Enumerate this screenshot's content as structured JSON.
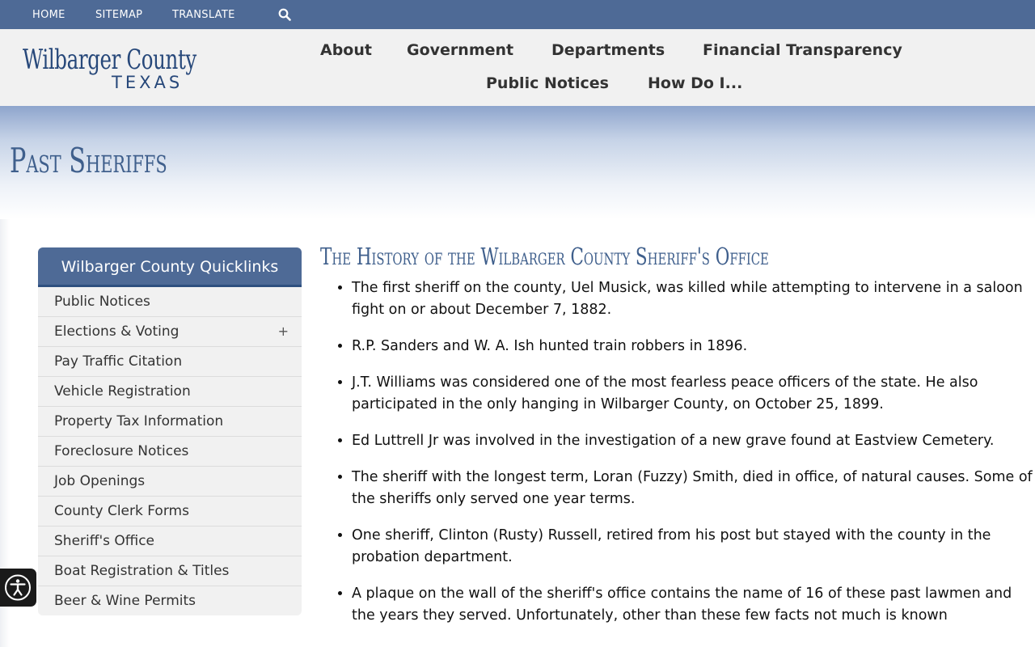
{
  "topbar": {
    "home": "HOME",
    "sitemap": "SITEMAP",
    "translate": "TRANSLATE",
    "search_icon": "search-icon"
  },
  "logo": {
    "line1": "Wilbarger County",
    "line2": "TEXAS"
  },
  "nav": {
    "about": "About",
    "government": "Government",
    "departments": "Departments",
    "financial": "Financial Transparency",
    "public_notices": "Public Notices",
    "how_do_i": "How Do I..."
  },
  "page": {
    "title": "Past Sheriffs"
  },
  "quicklinks": {
    "header": "Wilbarger County Quicklinks",
    "items": [
      {
        "label": "Public Notices"
      },
      {
        "label": "Elections & Voting",
        "expand": "+"
      },
      {
        "label": "Pay Traffic Citation"
      },
      {
        "label": "Vehicle Registration"
      },
      {
        "label": "Property Tax Information"
      },
      {
        "label": "Foreclosure Notices"
      },
      {
        "label": "Job Openings"
      },
      {
        "label": "County Clerk Forms"
      },
      {
        "label": "Sheriff's Office"
      },
      {
        "label": "Boat Registration & Titles"
      },
      {
        "label": "Beer & Wine Permits"
      }
    ]
  },
  "content": {
    "heading": "The History of the Wilbarger County Sheriff's Office",
    "bullets": [
      "The first sheriff on the county, Uel Musick, was killed while attempting to intervene in a saloon fight on or about December 7, 1882.",
      "R.P. Sanders and W. A. Ish hunted train robbers in 1896.",
      "J.T. Williams was considered one of the most fearless peace officers of the state. He also participated in the only hanging in Wilbarger County, on October 25, 1899.",
      "Ed Luttrell Jr was involved in the investigation of a new grave found at Eastview Cemetery.",
      "The sheriff with the longest term, Loran (Fuzzy) Smith, died in office, of natural causes. Some of the sheriffs only served one year terms.",
      "One sheriff, Clinton (Rusty) Russell, retired from his post but stayed with the county in the probation department.",
      "A plaque on the wall of the sheriff's office contains the name of 16 of these past lawmen and the years they served. Unfortunately, other than these few facts not much is known"
    ]
  },
  "accessibility": {
    "icon": "accessibility-icon"
  },
  "colors": {
    "topbar": "#4e6a96",
    "brand_blue": "#27487a",
    "title_blue": "#3f5f8c",
    "header_bg": "#f1f1f1"
  }
}
